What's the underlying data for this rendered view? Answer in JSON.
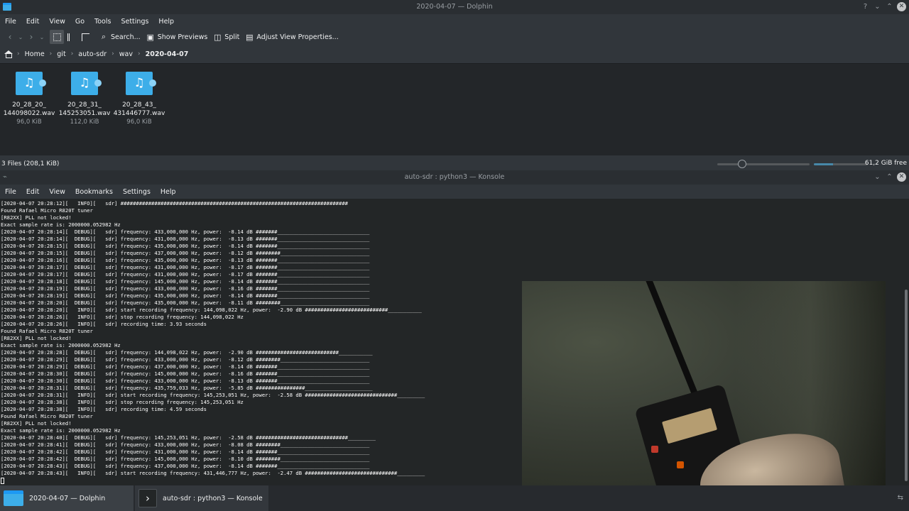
{
  "dolphin": {
    "title": "2020-04-07 — Dolphin",
    "menu": [
      "File",
      "Edit",
      "View",
      "Go",
      "Tools",
      "Settings",
      "Help"
    ],
    "toolbar": {
      "search": "Search...",
      "show_previews": "Show Previews",
      "split": "Split",
      "adjust": "Adjust View Properties..."
    },
    "breadcrumb": [
      "Home",
      "git",
      "auto-sdr",
      "wav",
      "2020-04-07"
    ],
    "files": [
      {
        "name_line1": "20_28_20_",
        "name_line2": "144098022.wav",
        "size": "96,0 KiB"
      },
      {
        "name_line1": "20_28_31_",
        "name_line2": "145253051.wav",
        "size": "112,0 KiB"
      },
      {
        "name_line1": "20_28_43_",
        "name_line2": "431446777.wav",
        "size": "96,0 KiB"
      }
    ],
    "status": "3 Files (208,1 KiB)",
    "free_space": "61,2 GiB free",
    "zoom_level": 0.27,
    "disk_used_fraction": 0.35
  },
  "konsole": {
    "title": "auto-sdr : python3 — Konsole",
    "menu": [
      "File",
      "Edit",
      "View",
      "Bookmarks",
      "Settings",
      "Help"
    ],
    "lines": [
      "[2020-04-07 20:28:12][   INFO][   sdr] ##########################################################################",
      "Found Rafael Micro R820T tuner",
      "[R82XX] PLL not locked!",
      "Exact sample rate is: 2000000.052982 Hz",
      "[2020-04-07 20:28:14][  DEBUG][   sdr] frequency: 433,000,000 Hz, power:  -8.14 dB #######______________________________",
      "[2020-04-07 20:28:14][  DEBUG][   sdr] frequency: 431,000,000 Hz, power:  -8.13 dB #######______________________________",
      "[2020-04-07 20:28:15][  DEBUG][   sdr] frequency: 435,000,000 Hz, power:  -8.14 dB #######______________________________",
      "[2020-04-07 20:28:15][  DEBUG][   sdr] frequency: 437,000,000 Hz, power:  -8.12 dB ########_____________________________",
      "[2020-04-07 20:28:16][  DEBUG][   sdr] frequency: 435,000,000 Hz, power:  -8.13 dB #######______________________________",
      "[2020-04-07 20:28:17][  DEBUG][   sdr] frequency: 431,000,000 Hz, power:  -8.17 dB #######______________________________",
      "[2020-04-07 20:28:17][  DEBUG][   sdr] frequency: 431,000,000 Hz, power:  -8.17 dB #######______________________________",
      "[2020-04-07 20:28:18][  DEBUG][   sdr] frequency: 145,000,000 Hz, power:  -8.14 dB #######______________________________",
      "[2020-04-07 20:28:19][  DEBUG][   sdr] frequency: 433,000,000 Hz, power:  -8.16 dB #######______________________________",
      "[2020-04-07 20:28:19][  DEBUG][   sdr] frequency: 435,000,000 Hz, power:  -8.14 dB #######______________________________",
      "[2020-04-07 20:28:20][  DEBUG][   sdr] frequency: 435,000,000 Hz, power:  -8.11 dB ########_____________________________",
      "[2020-04-07 20:28:20][   INFO][   sdr] start recording frequency: 144,098,022 Hz, power:  -2.90 dB ###########################___________",
      "[2020-04-07 20:28:26][   INFO][   sdr] stop recording frequency: 144,098,022 Hz",
      "[2020-04-07 20:28:26][   INFO][   sdr] recording time: 3.93 seconds",
      "Found Rafael Micro R820T tuner",
      "[R82XX] PLL not locked!",
      "Exact sample rate is: 2000000.052982 Hz",
      "[2020-04-07 20:28:28][  DEBUG][   sdr] frequency: 144,098,022 Hz, power:  -2.90 dB ###########################___________",
      "[2020-04-07 20:28:29][  DEBUG][   sdr] frequency: 433,000,000 Hz, power:  -8.12 dB ########_____________________________",
      "[2020-04-07 20:28:29][  DEBUG][   sdr] frequency: 437,000,000 Hz, power:  -8.14 dB #######______________________________",
      "[2020-04-07 20:28:30][  DEBUG][   sdr] frequency: 145,000,000 Hz, power:  -8.16 dB #######______________________________",
      "[2020-04-07 20:28:30][  DEBUG][   sdr] frequency: 433,000,000 Hz, power:  -8.13 dB #######______________________________",
      "[2020-04-07 20:28:31][  DEBUG][   sdr] frequency: 435,759,033 Hz, power:  -5.85 dB ################______________________",
      "[2020-04-07 20:28:31][   INFO][   sdr] start recording frequency: 145,253,051 Hz, power:  -2.58 dB ##############################_________",
      "[2020-04-07 20:28:38][   INFO][   sdr] stop recording frequency: 145,253,051 Hz",
      "[2020-04-07 20:28:38][   INFO][   sdr] recording time: 4.59 seconds",
      "Found Rafael Micro R820T tuner",
      "[R82XX] PLL not locked!",
      "Exact sample rate is: 2000000.052982 Hz",
      "[2020-04-07 20:28:40][  DEBUG][   sdr] frequency: 145,253,051 Hz, power:  -2.58 dB ##############################_________",
      "[2020-04-07 20:28:41][  DEBUG][   sdr] frequency: 433,000,000 Hz, power:  -8.08 dB ########_____________________________",
      "[2020-04-07 20:28:42][  DEBUG][   sdr] frequency: 431,000,000 Hz, power:  -8.14 dB #######______________________________",
      "[2020-04-07 20:28:42][  DEBUG][   sdr] frequency: 145,000,000 Hz, power:  -8.10 dB ########_____________________________",
      "[2020-04-07 20:28:43][  DEBUG][   sdr] frequency: 437,000,000 Hz, power:  -8.14 dB #######______________________________",
      "[2020-04-07 20:28:43][   INFO][   sdr] start recording frequency: 431,446,777 Hz, power:  -2.47 dB ##############################_________"
    ]
  },
  "taskbar": {
    "tasks": [
      "2020-04-07 — Dolphin",
      "auto-sdr : python3 — Konsole"
    ]
  },
  "icons": {
    "back": "chevron-left-icon",
    "forward": "chevron-right-icon",
    "search": "search-icon",
    "home": "home-icon",
    "audio_file": "audio-file-icon"
  }
}
